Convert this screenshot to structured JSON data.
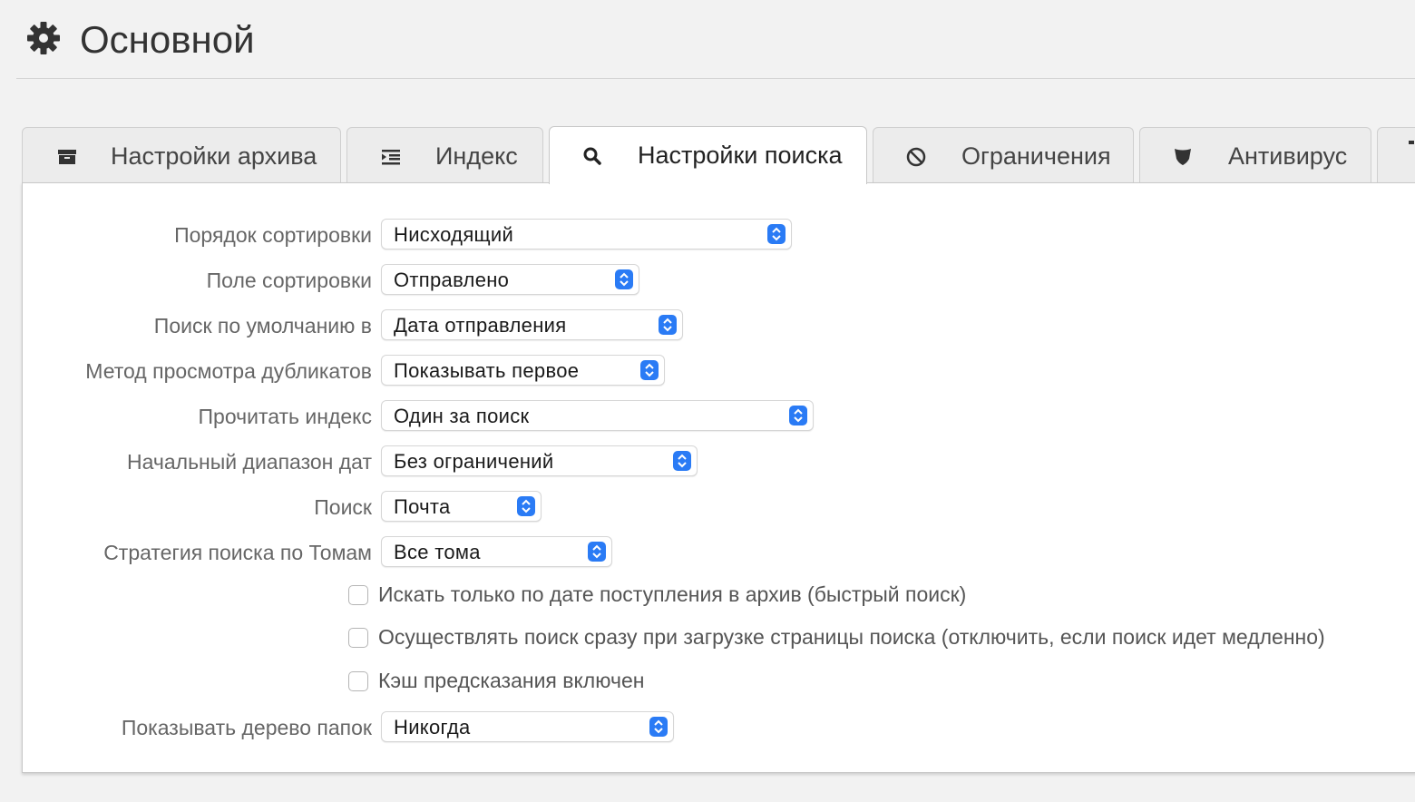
{
  "header": {
    "title": "Основной",
    "icon": "gear-icon"
  },
  "tabs": [
    {
      "label": "Настройки архива",
      "icon": "archive-icon",
      "active": false
    },
    {
      "label": "Индекс",
      "icon": "list-indent-icon",
      "active": false
    },
    {
      "label": "Настройки поиска",
      "icon": "search-icon",
      "active": true
    },
    {
      "label": "Ограничения",
      "icon": "ban-icon",
      "active": false
    },
    {
      "label": "Антивирус",
      "icon": "shield-icon",
      "active": false
    }
  ],
  "settings": {
    "sort_order": {
      "label": "Порядок сортировки",
      "value": "Нисходящий"
    },
    "sort_field": {
      "label": "Поле сортировки",
      "value": "Отправлено"
    },
    "default_search": {
      "label": "Поиск по умолчанию в",
      "value": "Дата отправления"
    },
    "duplicates_view": {
      "label": "Метод просмотра дубликатов",
      "value": "Показывать первое"
    },
    "read_index": {
      "label": "Прочитать индекс",
      "value": "Один за поиск"
    },
    "date_range": {
      "label": "Начальный диапазон дат",
      "value": "Без ограничений"
    },
    "search_type": {
      "label": "Поиск",
      "value": "Почта"
    },
    "volume_strategy": {
      "label": "Стратегия поиска по Томам",
      "value": "Все тома"
    },
    "checkboxes": [
      {
        "label": "Искать только по дате поступления в архив (быстрый поиск)",
        "checked": false
      },
      {
        "label": "Осуществлять поиск сразу при загрузке страницы поиска (отключить, если поиск идет медленно)",
        "checked": false
      },
      {
        "label": "Кэш предсказания включен",
        "checked": false
      }
    ],
    "folder_tree": {
      "label": "Показывать дерево папок",
      "value": "Никогда"
    }
  },
  "colors": {
    "accent": "#2a7bf5",
    "text": "#666666"
  }
}
